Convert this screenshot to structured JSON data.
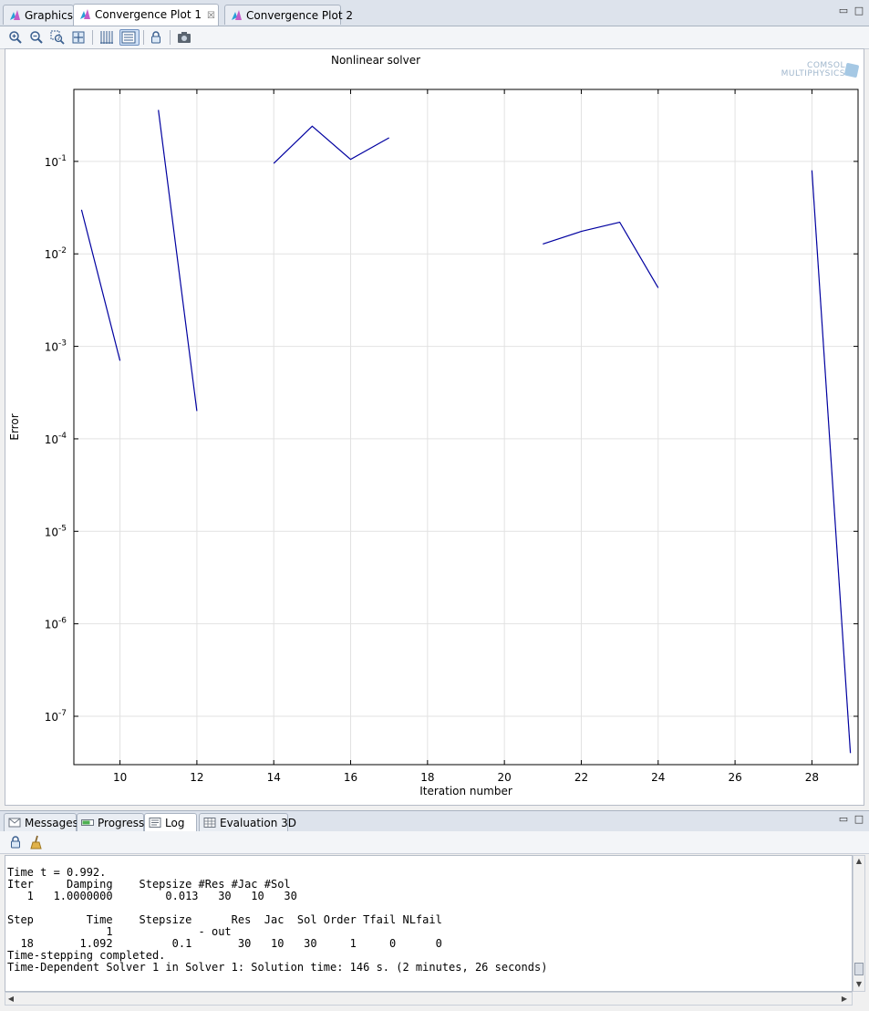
{
  "editor_tabs": [
    {
      "label": "Graphics",
      "icon": "graphics-icon"
    },
    {
      "label": "Convergence Plot 1",
      "icon": "convergence-plot-icon",
      "active": true,
      "closable": true
    },
    {
      "label": "Convergence Plot 2",
      "icon": "convergence-plot-icon"
    }
  ],
  "plot_toolbar": [
    {
      "name": "zoom-in-button",
      "icon": "zoom-in-icon"
    },
    {
      "name": "zoom-out-button",
      "icon": "zoom-out-icon"
    },
    {
      "name": "zoom-box-button",
      "icon": "zoom-box-icon"
    },
    {
      "name": "zoom-extents-button",
      "icon": "zoom-extents-icon"
    },
    {
      "name": "show-grid-button",
      "icon": "grid-icon"
    },
    {
      "name": "show-legend-button",
      "icon": "legend-icon",
      "pressed": true
    },
    {
      "name": "lock-axis-button",
      "icon": "lock-icon"
    },
    {
      "name": "image-snapshot-button",
      "icon": "camera-icon"
    }
  ],
  "logo": {
    "line1": "COMSOL",
    "line2": "MULTIPHYSICS"
  },
  "chart_data": {
    "type": "line",
    "title": "Nonlinear solver",
    "xlabel": "Iteration number",
    "ylabel": "Error",
    "xlim": [
      8.8,
      29.2
    ],
    "ylim": [
      3e-08,
      0.6
    ],
    "yscale": "log",
    "grid": true,
    "xticks": [
      10,
      12,
      14,
      16,
      18,
      20,
      22,
      24,
      26,
      28
    ],
    "yticks": [
      {
        "value": 0.1,
        "base": "10",
        "exp": "-1"
      },
      {
        "value": 0.01,
        "base": "10",
        "exp": "-2"
      },
      {
        "value": 0.001,
        "base": "10",
        "exp": "-3"
      },
      {
        "value": 0.0001,
        "base": "10",
        "exp": "-4"
      },
      {
        "value": 1e-05,
        "base": "10",
        "exp": "-5"
      },
      {
        "value": 1e-06,
        "base": "10",
        "exp": "-6"
      },
      {
        "value": 1e-07,
        "base": "10",
        "exp": "-7"
      }
    ],
    "color": "#0000a0",
    "segments": [
      {
        "x": [
          9,
          10
        ],
        "y": [
          0.03,
          0.0007
        ]
      },
      {
        "x": [
          11,
          12
        ],
        "y": [
          0.36,
          0.0002
        ]
      },
      {
        "x": [
          14,
          15,
          16,
          17
        ],
        "y": [
          0.095,
          0.24,
          0.105,
          0.18
        ]
      },
      {
        "x": [
          21,
          22,
          23,
          24
        ],
        "y": [
          0.0128,
          0.0175,
          0.022,
          0.0043
        ]
      },
      {
        "x": [
          28,
          29
        ],
        "y": [
          0.08,
          4e-08
        ]
      }
    ]
  },
  "lower_tabs": [
    {
      "label": "Messages",
      "icon": "messages-icon"
    },
    {
      "label": "Progress",
      "icon": "progress-icon"
    },
    {
      "label": "Log",
      "icon": "log-icon",
      "active": true
    },
    {
      "label": "Evaluation 3D",
      "icon": "table-icon"
    }
  ],
  "log_toolbar": [
    {
      "name": "lock-scroll-button",
      "icon": "lock-icon"
    },
    {
      "name": "clear-log-button",
      "icon": "broom-icon"
    }
  ],
  "log_lines": [
    "Time t = 0.992.",
    "Iter     Damping    Stepsize #Res #Jac #Sol",
    "   1   1.0000000        0.013   30   10   30",
    "",
    "Step        Time    Stepsize      Res  Jac  Sol Order Tfail NLfail",
    "               1             - out",
    "  18       1.092         0.1       30   10   30     1     0      0",
    "Time-stepping completed.",
    "Time-Dependent Solver 1 in Solver 1: Solution time: 146 s. (2 minutes, 26 seconds)"
  ]
}
